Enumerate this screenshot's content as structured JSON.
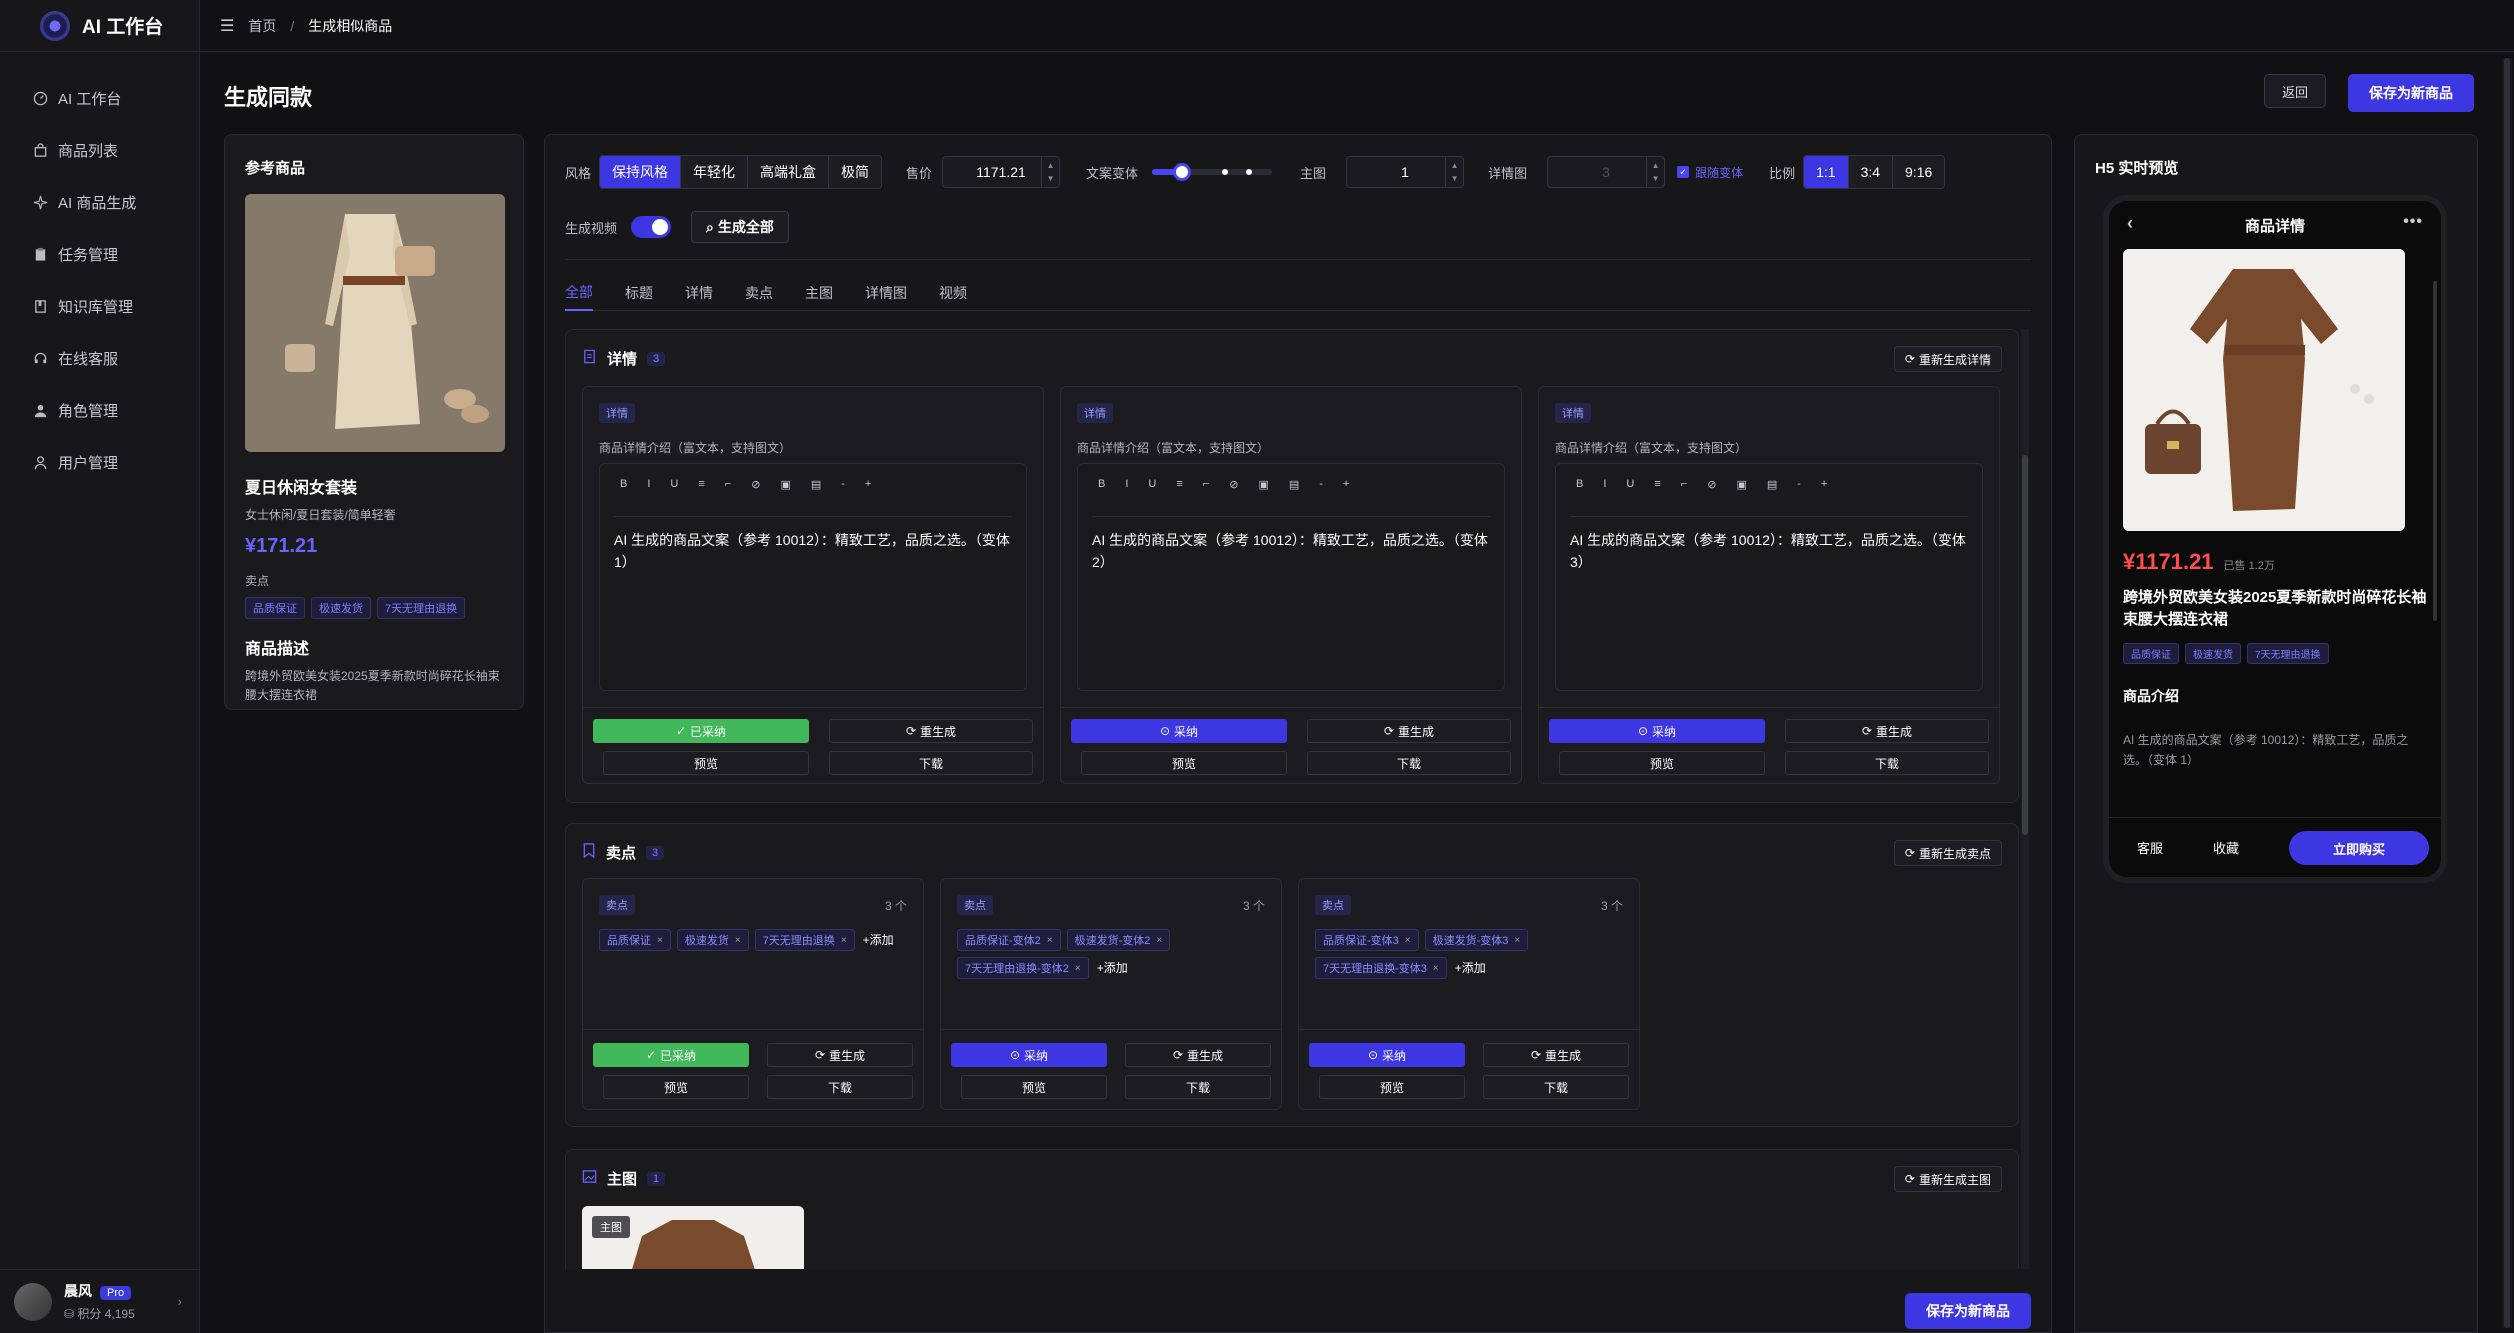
{
  "app": {
    "title": "AI 工作台"
  },
  "sidebar": {
    "items": [
      {
        "label": "AI 工作台",
        "icon": "gauge-icon"
      },
      {
        "label": "商品列表",
        "icon": "bag-icon"
      },
      {
        "label": "AI 商品生成",
        "icon": "sparkle-icon"
      },
      {
        "label": "任务管理",
        "icon": "clipboard-icon"
      },
      {
        "label": "知识库管理",
        "icon": "book-icon"
      },
      {
        "label": "在线客服",
        "icon": "headset-icon"
      },
      {
        "label": "角色管理",
        "icon": "person-icon"
      },
      {
        "label": "用户管理",
        "icon": "user-icon"
      }
    ],
    "user": {
      "name": "晨风",
      "badge": "Pro",
      "points": "积分 4,195"
    }
  },
  "breadcrumb": {
    "home": "首页",
    "sep": "/",
    "current": "生成相似商品"
  },
  "page": {
    "title": "生成同款",
    "back_label": "返回",
    "save_label": "保存为新商品"
  },
  "reference": {
    "heading": "参考商品",
    "title": "夏日休闲女套装",
    "subtitle": "女士休闲/夏日套装/简单轻奢",
    "price": "¥171.21",
    "selling_label": "卖点",
    "tags": [
      "品质保证",
      "极速发货",
      "7天无理由退换"
    ],
    "desc_heading": "商品描述",
    "desc": "跨境外贸欧美女装2025夏季新款时尚碎花长袖束腰大摆连衣裙"
  },
  "controls": {
    "style_label": "风格",
    "styles": [
      "保持风格",
      "年轻化",
      "高端礼盒",
      "极简"
    ],
    "price_label": "售价",
    "price_value": "1171.21",
    "variant_label": "文案变体",
    "variant_level": 0.25,
    "main_label": "主图",
    "main_value": "1",
    "detail_label": "详情图",
    "detail_value": "3",
    "follow_label": "跟随变体",
    "ratio_label": "比例",
    "ratios": [
      "1:1",
      "3:4",
      "9:16"
    ],
    "video_label": "生成视频",
    "gen_all_label": "生成全部"
  },
  "tabs": [
    "全部",
    "标题",
    "详情",
    "卖点",
    "主图",
    "详情图",
    "视频"
  ],
  "detail_section": {
    "title": "详情",
    "count": "3",
    "regen_label": "重新生成详情",
    "cards": [
      {
        "chip": "详情",
        "label": "商品详情介绍（富文本，支持图文）",
        "text": "AI 生成的商品文案（参考 10012）：精致工艺，品质之选。（变体 1）",
        "adopt": "已采纳",
        "adopted": true
      },
      {
        "chip": "详情",
        "label": "商品详情介绍（富文本，支持图文）",
        "text": "AI 生成的商品文案（参考 10012）：精致工艺，品质之选。（变体 2）",
        "adopt": "采纳",
        "adopted": false
      },
      {
        "chip": "详情",
        "label": "商品详情介绍（富文本，支持图文）",
        "text": "AI 生成的商品文案（参考 10012）：精致工艺，品质之选。（变体 3）",
        "adopt": "采纳",
        "adopted": false
      }
    ],
    "toolbar": [
      "B",
      "I",
      "U",
      "≡",
      "⌐",
      "⊘",
      "▣",
      "▤",
      "-",
      "+"
    ],
    "regen": "重生成",
    "preview": "预览",
    "download": "下载"
  },
  "selling_section": {
    "title": "卖点",
    "count": "3",
    "regen_label": "重新生成卖点",
    "cards": [
      {
        "chip": "卖点",
        "count": "3 个",
        "tags": [
          "品质保证",
          "极速发货",
          "7天无理由退换"
        ],
        "adopt": "已采纳",
        "adopted": true
      },
      {
        "chip": "卖点",
        "count": "3 个",
        "tags": [
          "品质保证-变体2",
          "极速发货-变体2",
          "7天无理由退换-变体2"
        ],
        "adopt": "采纳",
        "adopted": false
      },
      {
        "chip": "卖点",
        "count": "3 个",
        "tags": [
          "品质保证-变体3",
          "极速发货-变体3",
          "7天无理由退换-变体3"
        ],
        "adopt": "采纳",
        "adopted": false
      }
    ],
    "add_label": "添加"
  },
  "main_section": {
    "title": "主图",
    "count": "1",
    "regen_label": "重新生成主图",
    "badge": "主图"
  },
  "preview": {
    "heading": "H5 实时预览",
    "header": "商品详情",
    "price": "¥1171.21",
    "sold": "已售 1.2万",
    "title": "跨境外贸欧美女装2025夏季新款时尚碎花长袖束腰大摆连衣裙",
    "tags": [
      "品质保证",
      "极速发货",
      "7天无理由退换"
    ],
    "intro_heading": "商品介绍",
    "intro": "AI 生成的商品文案（参考 10012）：精致工艺，品质之选。（变体 1）",
    "service": "客服",
    "favorite": "收藏",
    "buy": "立即购买"
  },
  "colors": {
    "accent": "#3d37e3",
    "adopted": "#41b85a",
    "price_red": "#ff4d4d"
  }
}
